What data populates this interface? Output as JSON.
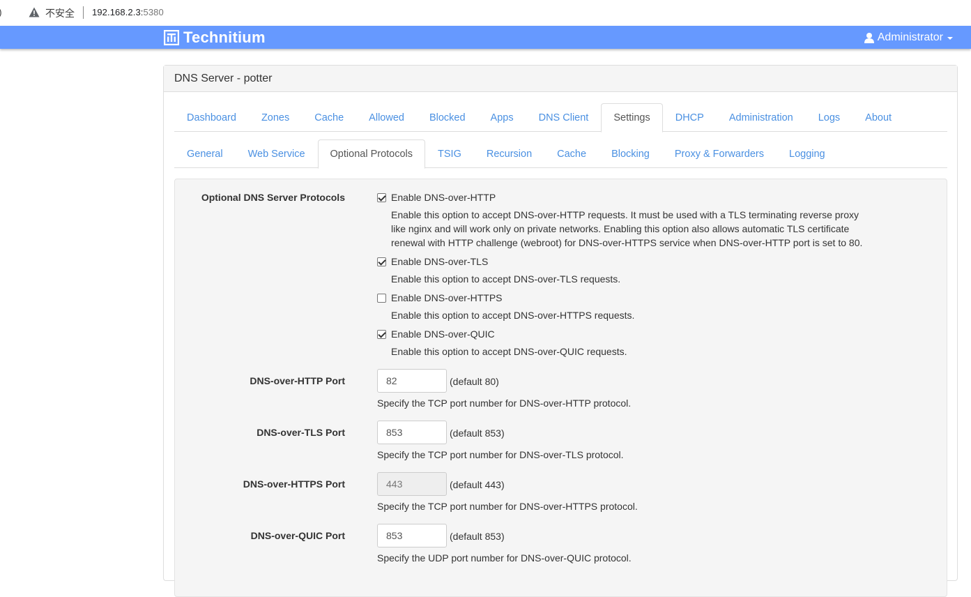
{
  "browser": {
    "security_label": "不安全",
    "url_host": "192.168.2.3:",
    "url_port": "5380"
  },
  "header": {
    "brand": "Technitium",
    "user": "Administrator"
  },
  "panel": {
    "title": "DNS Server - potter"
  },
  "main_tabs": [
    {
      "label": "Dashboard"
    },
    {
      "label": "Zones"
    },
    {
      "label": "Cache"
    },
    {
      "label": "Allowed"
    },
    {
      "label": "Blocked"
    },
    {
      "label": "Apps"
    },
    {
      "label": "DNS Client"
    },
    {
      "label": "Settings"
    },
    {
      "label": "DHCP"
    },
    {
      "label": "Administration"
    },
    {
      "label": "Logs"
    },
    {
      "label": "About"
    }
  ],
  "sub_tabs": [
    {
      "label": "General"
    },
    {
      "label": "Web Service"
    },
    {
      "label": "Optional Protocols"
    },
    {
      "label": "TSIG"
    },
    {
      "label": "Recursion"
    },
    {
      "label": "Cache"
    },
    {
      "label": "Blocking"
    },
    {
      "label": "Proxy & Forwarders"
    },
    {
      "label": "Logging"
    }
  ],
  "protocols": {
    "section_label": "Optional DNS Server Protocols",
    "options": [
      {
        "label": "Enable DNS-over-HTTP",
        "checked": true,
        "help": "Enable this option to accept DNS-over-HTTP requests. It must be used with a TLS terminating reverse proxy like nginx and will work only on private networks. Enabling this option also allows automatic TLS certificate renewal with HTTP challenge (webroot) for DNS-over-HTTPS service when DNS-over-HTTP port is set to 80."
      },
      {
        "label": "Enable DNS-over-TLS",
        "checked": true,
        "help": "Enable this option to accept DNS-over-TLS requests."
      },
      {
        "label": "Enable DNS-over-HTTPS",
        "checked": false,
        "help": "Enable this option to accept DNS-over-HTTPS requests."
      },
      {
        "label": "Enable DNS-over-QUIC",
        "checked": true,
        "help": "Enable this option to accept DNS-over-QUIC requests."
      }
    ]
  },
  "ports": [
    {
      "label": "DNS-over-HTTP Port",
      "value": "82",
      "default": "(default 80)",
      "disabled": false,
      "help": "Specify the TCP port number for DNS-over-HTTP protocol."
    },
    {
      "label": "DNS-over-TLS Port",
      "value": "853",
      "default": "(default 853)",
      "disabled": false,
      "help": "Specify the TCP port number for DNS-over-TLS protocol."
    },
    {
      "label": "DNS-over-HTTPS Port",
      "value": "443",
      "default": "(default 443)",
      "disabled": true,
      "help": "Specify the TCP port number for DNS-over-HTTPS protocol."
    },
    {
      "label": "DNS-over-QUIC Port",
      "value": "853",
      "default": "(default 853)",
      "disabled": false,
      "help": "Specify the UDP port number for DNS-over-QUIC protocol."
    }
  ]
}
